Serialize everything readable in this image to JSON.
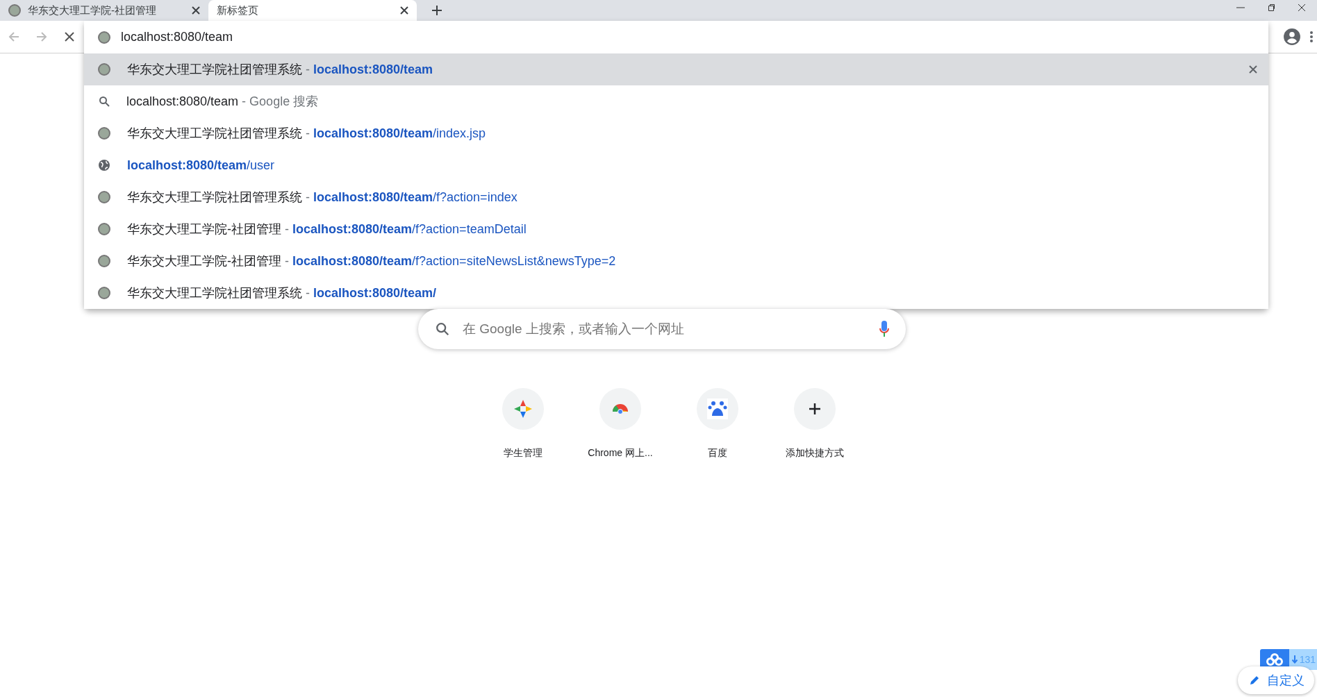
{
  "tabs": [
    {
      "title": "华东交大理工学院-社团管理",
      "selected": false
    },
    {
      "title": "新标签页",
      "selected": true
    }
  ],
  "address_bar": {
    "value": "localhost:8080/team"
  },
  "suggestions": [
    {
      "kind": "page",
      "title": "华东交大理工学院社团管理系统",
      "separator": "-",
      "url_match": "localhost:8080/team",
      "selected": true
    },
    {
      "kind": "search",
      "title": "localhost:8080/team",
      "separator": "-",
      "suffix": "Google 搜索",
      "selected": false
    },
    {
      "kind": "page",
      "title": "华东交大理工学院社团管理系统",
      "separator": "-",
      "url_match": "localhost:8080/team",
      "url_rest": "/index.jsp",
      "selected": false
    },
    {
      "kind": "site",
      "url_match": "localhost:8080/team",
      "url_rest": "/user",
      "selected": false
    },
    {
      "kind": "page",
      "title": "华东交大理工学院社团管理系统",
      "separator": "-",
      "url_match": "localhost:8080/team",
      "url_rest": "/f?action=index",
      "selected": false
    },
    {
      "kind": "page",
      "title": "华东交大理工学院-社团管理",
      "separator": "-",
      "url_match": "localhost:8080/team",
      "url_rest": "/f?action=teamDetail",
      "selected": false
    },
    {
      "kind": "page",
      "title": "华东交大理工学院-社团管理",
      "separator": "-",
      "url_match": "localhost:8080/team",
      "url_rest": "/f?action=siteNewsList&newsType=2",
      "selected": false
    },
    {
      "kind": "page",
      "title": "华东交大理工学院社团管理系统",
      "separator": "-",
      "url_match": "localhost:8080/team/",
      "selected": false
    }
  ],
  "search": {
    "placeholder": "在 Google 上搜索，或者输入一个网址"
  },
  "shortcuts": [
    {
      "kind": "star",
      "label": "学生管理"
    },
    {
      "kind": "chrome",
      "label": "Chrome 网上..."
    },
    {
      "kind": "paw",
      "label": "百度"
    },
    {
      "kind": "add",
      "label": "添加快捷方式"
    }
  ],
  "download_widget": {
    "count": "131"
  },
  "customize_button": {
    "label": "自定义"
  }
}
